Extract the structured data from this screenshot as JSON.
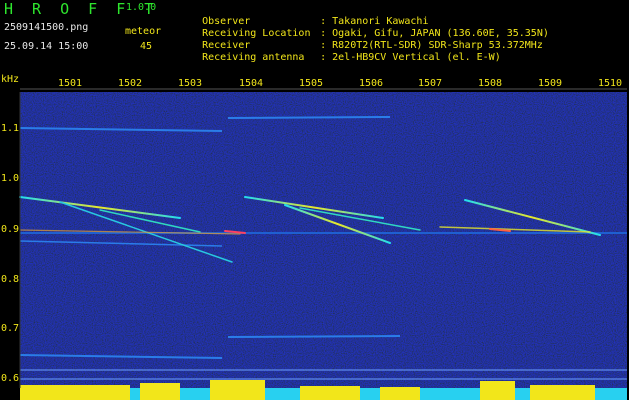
{
  "app": {
    "name": "H R O F F T",
    "version": "1.0.0"
  },
  "file_name": "2509141500.png",
  "timestamp": "25.09.14 15:00",
  "meteor_label": "meteor",
  "meteor_count": "45",
  "info": [
    {
      "label": "Observer",
      "value": ": Takanori Kawachi"
    },
    {
      "label": "Receiving Location",
      "value": ": Ogaki, Gifu, JAPAN (136.60E, 35.35N)"
    },
    {
      "label": "Receiver",
      "value": ": R820T2(RTL-SDR) SDR-Sharp 53.372MHz"
    },
    {
      "label": "Receiving antenna",
      "value": ": 2el-HB9CV Vertical (el. E-W)"
    }
  ],
  "axis": {
    "y_unit": "kHz",
    "x_ticks": [
      "1501",
      "1502",
      "1503",
      "1504",
      "1505",
      "1506",
      "1507",
      "1508",
      "1509",
      "1510"
    ],
    "y_ticks": [
      "1.1",
      "1.0",
      "0.9",
      "0.8",
      "0.7",
      "0.6"
    ]
  },
  "colors": {
    "accent_green": "#2ee62e",
    "label_yellow": "#f2e61a",
    "background": "#000000",
    "plot_noise": "#0a0f55"
  }
}
